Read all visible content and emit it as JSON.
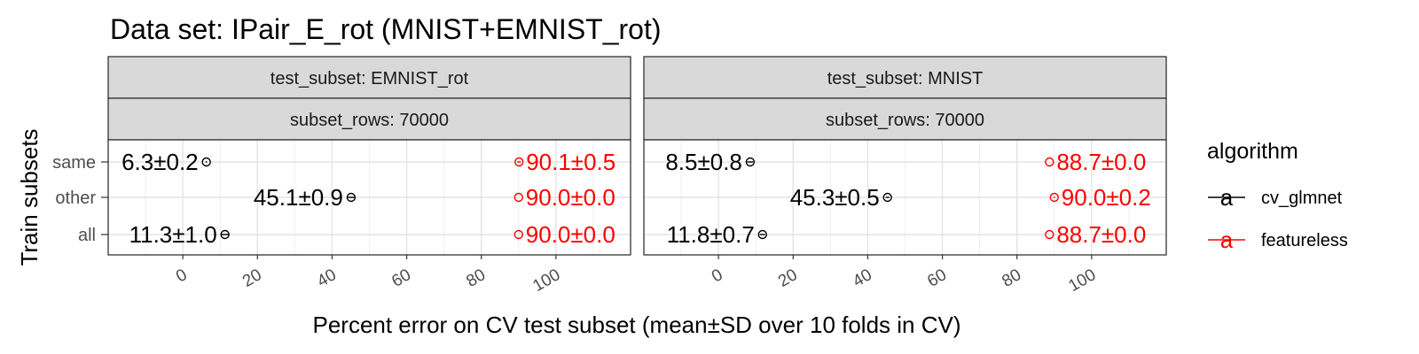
{
  "chart_data": {
    "type": "scatter",
    "title": "Data set: IPair_E_rot (MNIST+EMNIST_rot)",
    "xlabel": "Percent error on CV test subset (mean±SD over 10 folds in CV)",
    "ylabel": "Train subsets",
    "categories": [
      "same",
      "other",
      "all"
    ],
    "xlim": [
      -20,
      120
    ],
    "x_ticks": [
      0,
      20,
      40,
      60,
      80,
      100
    ],
    "x_tick_labels": [
      "0",
      "20",
      "40",
      "60",
      "80",
      "100"
    ],
    "grid": true,
    "legend": {
      "title": "algorithm",
      "position": "right",
      "entries": [
        {
          "name": "cv_glmnet",
          "color": "#000000",
          "key": "a"
        },
        {
          "name": "featureless",
          "color": "#ff0000",
          "key": "a"
        }
      ]
    },
    "panels": [
      {
        "strip_top": "test_subset: EMNIST_rot",
        "strip_bottom": "subset_rows: 70000",
        "series": [
          {
            "name": "cv_glmnet",
            "color": "#000000",
            "label_side": "left",
            "points": [
              {
                "category": "same",
                "mean": 6.3,
                "sd": 0.2,
                "label": "6.3±0.2"
              },
              {
                "category": "other",
                "mean": 45.1,
                "sd": 0.9,
                "label": "45.1±0.9"
              },
              {
                "category": "all",
                "mean": 11.3,
                "sd": 1.0,
                "label": "11.3±1.0"
              }
            ]
          },
          {
            "name": "featureless",
            "color": "#ff0000",
            "label_side": "right",
            "points": [
              {
                "category": "same",
                "mean": 90.1,
                "sd": 0.5,
                "label": "90.1±0.5"
              },
              {
                "category": "other",
                "mean": 90.0,
                "sd": 0.0,
                "label": "90.0±0.0"
              },
              {
                "category": "all",
                "mean": 90.0,
                "sd": 0.0,
                "label": "90.0±0.0"
              }
            ]
          }
        ]
      },
      {
        "strip_top": "test_subset: MNIST",
        "strip_bottom": "subset_rows: 70000",
        "series": [
          {
            "name": "cv_glmnet",
            "color": "#000000",
            "label_side": "left",
            "points": [
              {
                "category": "same",
                "mean": 8.5,
                "sd": 0.8,
                "label": "8.5±0.8"
              },
              {
                "category": "other",
                "mean": 45.3,
                "sd": 0.5,
                "label": "45.3±0.5"
              },
              {
                "category": "all",
                "mean": 11.8,
                "sd": 0.7,
                "label": "11.8±0.7"
              }
            ]
          },
          {
            "name": "featureless",
            "color": "#ff0000",
            "label_side": "right",
            "points": [
              {
                "category": "same",
                "mean": 88.7,
                "sd": 0.0,
                "label": "88.7±0.0"
              },
              {
                "category": "other",
                "mean": 90.0,
                "sd": 0.2,
                "label": "90.0±0.2"
              },
              {
                "category": "all",
                "mean": 88.7,
                "sd": 0.0,
                "label": "88.7±0.0"
              }
            ]
          }
        ]
      }
    ]
  }
}
